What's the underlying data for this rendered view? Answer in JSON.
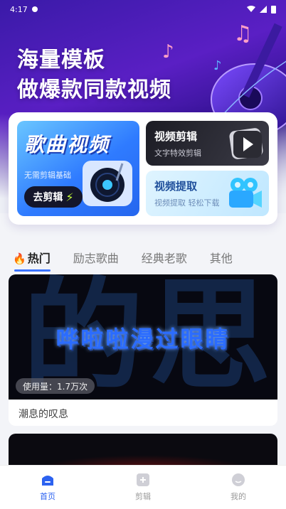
{
  "status_bar": {
    "time": "4:17"
  },
  "hero": {
    "line1": "海量模板",
    "line2": "做爆款同款视频"
  },
  "song_card": {
    "title": "歌曲视频",
    "subtitle": "无需剪辑基础",
    "button": "去剪辑"
  },
  "video_edit_card": {
    "title": "视频剪辑",
    "subtitle": "文字特效剪辑"
  },
  "video_extract_card": {
    "title": "视频提取",
    "subtitle": "视频提取 轻松下载"
  },
  "tabs": [
    {
      "label": "热门",
      "active": true
    },
    {
      "label": "励志歌曲",
      "active": false
    },
    {
      "label": "经典老歌",
      "active": false
    },
    {
      "label": "其他",
      "active": false
    }
  ],
  "video_list": [
    {
      "overlay_text": "哗啦啦漫过眼睛",
      "usage": "使用量：1.7万次",
      "caption": "潮息的叹息"
    }
  ],
  "bottom_nav": [
    {
      "label": "首页",
      "icon": "home-icon",
      "active": true
    },
    {
      "label": "剪辑",
      "icon": "edit-plus-icon",
      "active": false
    },
    {
      "label": "我的",
      "icon": "profile-icon",
      "active": false
    }
  ],
  "colors": {
    "accent": "#2c62f0",
    "hero_purple": "#4a1cc0",
    "hot_fire": "#ff3b2f"
  }
}
